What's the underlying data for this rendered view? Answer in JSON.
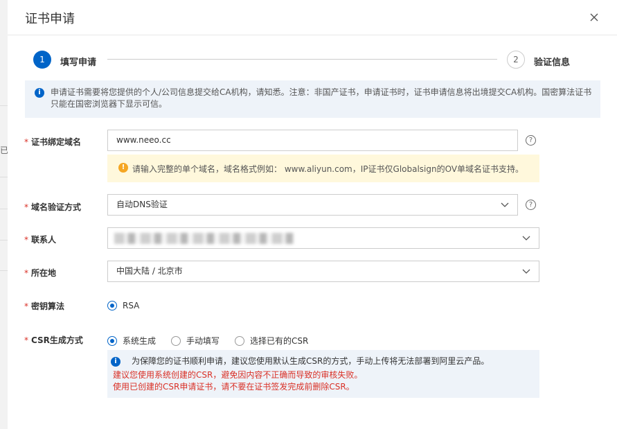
{
  "dialog": {
    "title": "证书申请"
  },
  "backdrop": {
    "fragment": "已"
  },
  "steps": [
    {
      "number": "1",
      "label": "填写申请",
      "active": true
    },
    {
      "number": "2",
      "label": "验证信息",
      "active": false
    }
  ],
  "notice": {
    "text": "申请证书需要将您提供的个人/公司信息提交给CA机构，请知悉。注意：非国产证书，申请证书时，证书申请信息将出境提交CA机构。国密算法证书只能在国密浏览器下显示可信。"
  },
  "form": {
    "required_mark": "*",
    "domain": {
      "label": "证书绑定域名",
      "value": "www.neeo.cc",
      "hint": "请输入完整的单个域名，域名格式例如： www.aliyun.com，IP证书仅Globalsign的OV单域名证书支持。"
    },
    "verify_method": {
      "label": "域名验证方式",
      "value": "自动DNS验证"
    },
    "contact": {
      "label": "联系人"
    },
    "location": {
      "label": "所在地",
      "value": "中国大陆 / 北京市"
    },
    "key_algorithm": {
      "label": "密钥算法",
      "options": [
        "RSA"
      ]
    },
    "csr": {
      "label": "CSR生成方式",
      "options": [
        "系统生成",
        "手动填写",
        "选择已有的CSR"
      ],
      "info": "为保障您的证书顺利申请，建议您使用默认生成CSR的方式，手动上传将无法部署到阿里云产品。",
      "warning_1": "建议您使用系统创建的CSR，避免因内容不正确而导致的审核失败。",
      "warning_2": "使用已创建的CSR申请证书，请不要在证书签发完成前删除CSR。"
    }
  },
  "colors": {
    "primary": "#0064c8",
    "required": "#d93026",
    "warning_bg": "#fff8dc",
    "info_bg": "#eef3f9"
  }
}
